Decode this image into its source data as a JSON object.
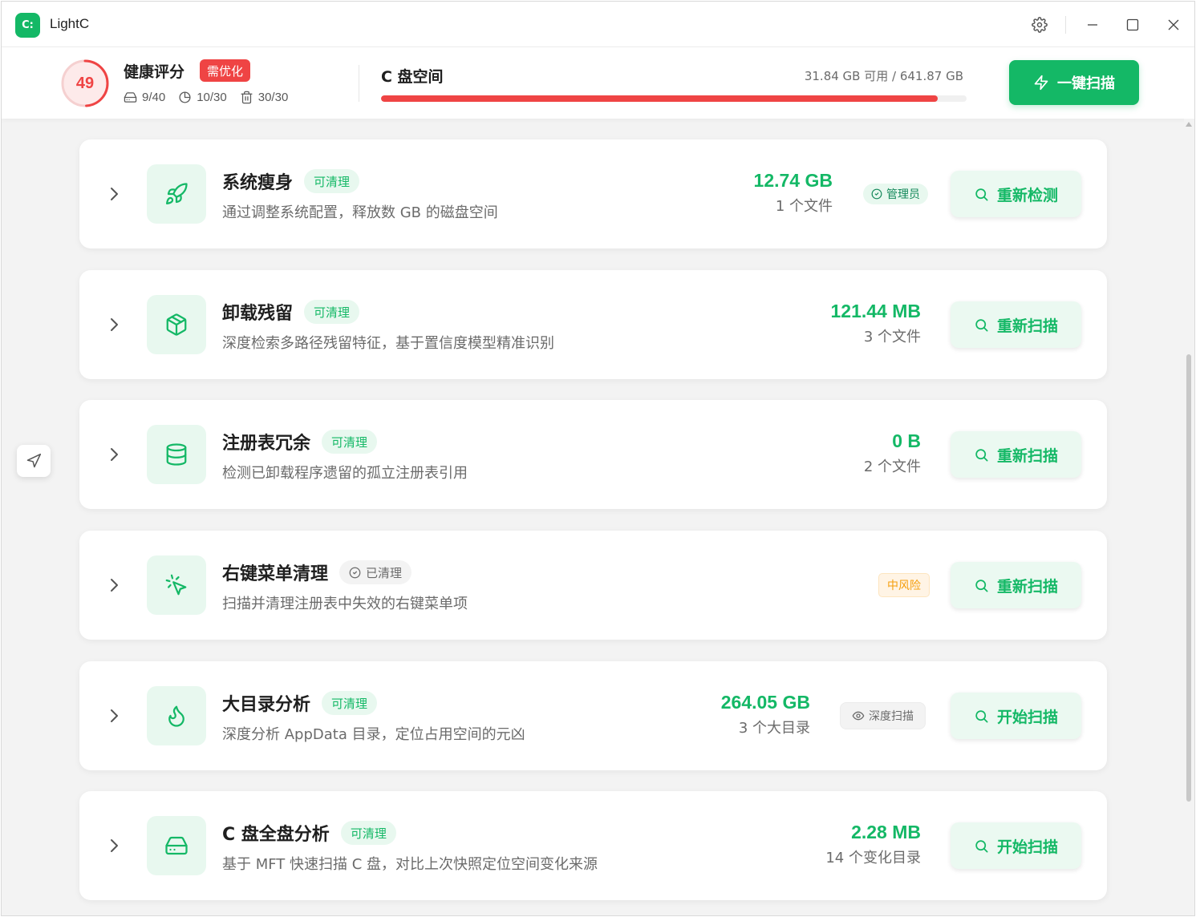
{
  "app": {
    "logo_text": "C:",
    "title": "LightC"
  },
  "header": {
    "score": "49",
    "health_title": "健康评分",
    "health_badge": "需优化",
    "stats": [
      {
        "icon": "drive-icon",
        "value": "9/40"
      },
      {
        "icon": "clock-icon",
        "value": "10/30"
      },
      {
        "icon": "trash-icon",
        "value": "30/30"
      }
    ],
    "disk_title": "C 盘空间",
    "disk_info": "31.84 GB 可用 / 641.87 GB",
    "disk_used_fraction": 0.95,
    "scan_all_label": "一键扫描"
  },
  "colors": {
    "accent": "#14b866",
    "danger": "#ef4444",
    "warning": "#f59e0b"
  },
  "cards": [
    {
      "icon": "rocket-icon",
      "title": "系统瘦身",
      "tag": "可清理",
      "tag_type": "clean",
      "desc": "通过调整系统配置，释放数 GB 的磁盘空间",
      "size": "12.74 GB",
      "sub": "1 个文件",
      "chip": "管理员",
      "chip_type": "admin",
      "action": "重新检测"
    },
    {
      "icon": "package-icon",
      "title": "卸载残留",
      "tag": "可清理",
      "tag_type": "clean",
      "desc": "深度检索多路径残留特征，基于置信度模型精准识别",
      "size": "121.44 MB",
      "sub": "3 个文件",
      "chip": "",
      "chip_type": "",
      "action": "重新扫描"
    },
    {
      "icon": "database-icon",
      "title": "注册表冗余",
      "tag": "可清理",
      "tag_type": "clean",
      "desc": "检测已卸载程序遗留的孤立注册表引用",
      "size": "0 B",
      "sub": "2 个文件",
      "chip": "",
      "chip_type": "",
      "action": "重新扫描"
    },
    {
      "icon": "cursor-click-icon",
      "title": "右键菜单清理",
      "tag": "已清理",
      "tag_type": "done",
      "desc": "扫描并清理注册表中失效的右键菜单项",
      "size": "",
      "sub": "",
      "chip": "中风险",
      "chip_type": "risk",
      "action": "重新扫描"
    },
    {
      "icon": "flame-icon",
      "title": "大目录分析",
      "tag": "可清理",
      "tag_type": "clean",
      "desc": "深度分析 AppData 目录，定位占用空间的元凶",
      "size": "264.05 GB",
      "sub": "3 个大目录",
      "chip": "深度扫描",
      "chip_type": "deep",
      "action": "开始扫描"
    },
    {
      "icon": "hard-drive-icon",
      "title": "C 盘全盘分析",
      "tag": "可清理",
      "tag_type": "clean",
      "desc": "基于 MFT 快速扫描 C 盘，对比上次快照定位空间变化来源",
      "size": "2.28 MB",
      "sub": "14 个变化目录",
      "chip": "",
      "chip_type": "",
      "action": "开始扫描"
    }
  ]
}
